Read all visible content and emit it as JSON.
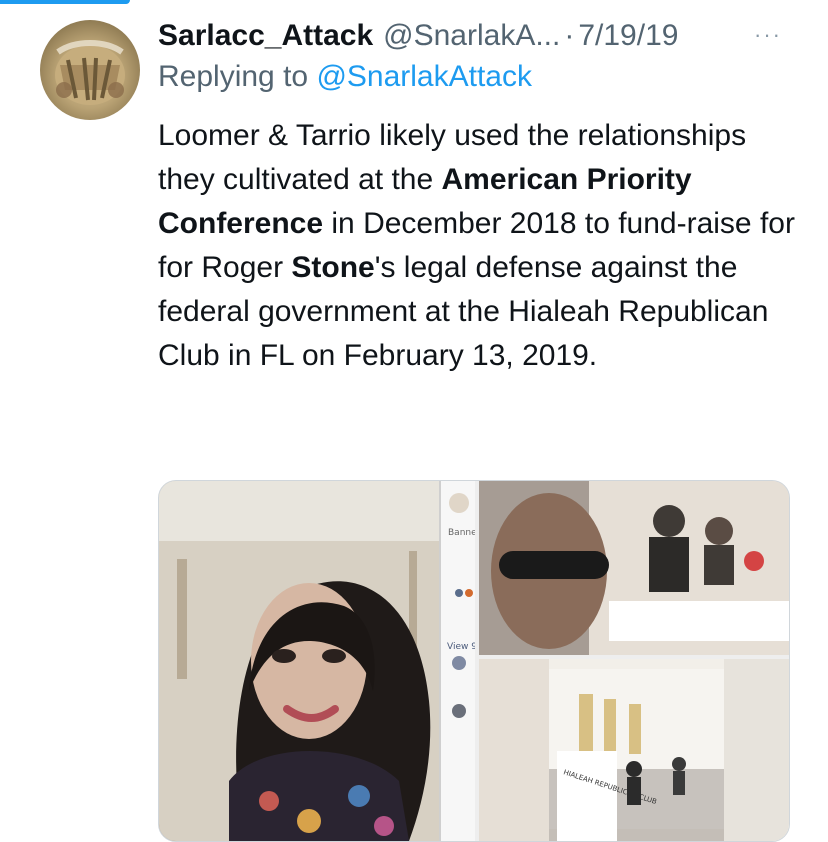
{
  "tweet": {
    "display_name": "Sarlacc_Attack",
    "handle": "@SnarlakA...",
    "separator": "·",
    "date": "7/19/19",
    "more_label": "···",
    "reply_prefix": "Replying to",
    "reply_handle": "@SnarlakAttack",
    "text": {
      "p1": "Loomer & Tarrio likely used the relationships they cultivated at the",
      "b1": "American Priority Conference",
      "p2": " in December 2018 to fund-raise for for Roger ",
      "b2": "Stone",
      "p3": "'s legal defense against the federal government at the Hialeah Republican Club in FL on February 13, 2019."
    }
  },
  "media": {
    "left_panel": {
      "sidebar_text_1": "Banne",
      "sidebar_text_2": "View 9"
    },
    "bottom_right": {
      "sign_text": "HIALEAH REPUBLICAN CLUB"
    }
  },
  "colors": {
    "accent": "#1d9bf0",
    "text_primary": "#0f1419",
    "text_secondary": "#536471"
  },
  "icons": {
    "more": "more-horizontal-icon"
  }
}
